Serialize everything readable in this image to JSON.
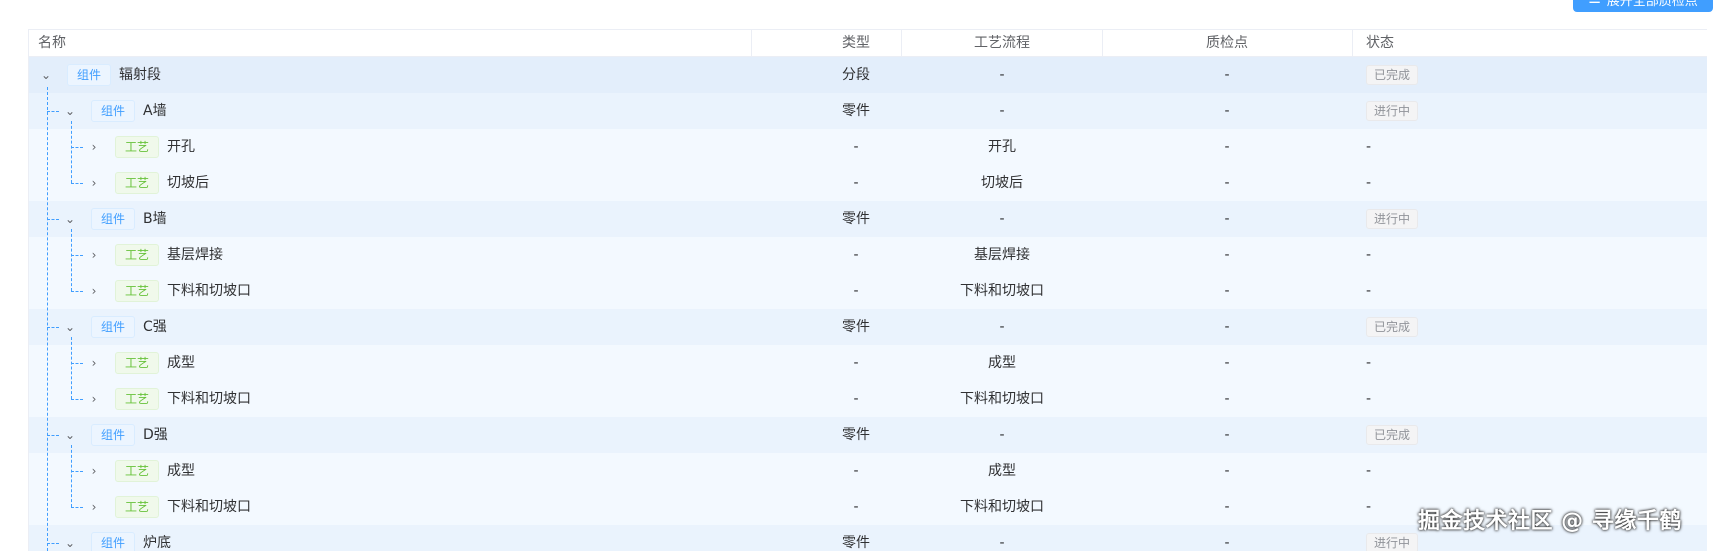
{
  "toolbar": {
    "expand_all_label": "展开全部质检点"
  },
  "columns": {
    "name": "名称",
    "type": "类型",
    "process": "工艺流程",
    "qc": "质检点",
    "status": "状态"
  },
  "rows": [
    {
      "tag": "组件",
      "name": "辐射段",
      "type": "分段",
      "process": "-",
      "qc": "-",
      "status": "已完成"
    },
    {
      "tag": "组件",
      "name": "A墙",
      "type": "零件",
      "process": "-",
      "qc": "-",
      "status": "进行中"
    },
    {
      "tag": "工艺",
      "name": "开孔",
      "type": "-",
      "process": "开孔",
      "qc": "-",
      "status": "-"
    },
    {
      "tag": "工艺",
      "name": "切坡后",
      "type": "-",
      "process": "切坡后",
      "qc": "-",
      "status": "-"
    },
    {
      "tag": "组件",
      "name": "B墙",
      "type": "零件",
      "process": "-",
      "qc": "-",
      "status": "进行中"
    },
    {
      "tag": "工艺",
      "name": "基层焊接",
      "type": "-",
      "process": "基层焊接",
      "qc": "-",
      "status": "-"
    },
    {
      "tag": "工艺",
      "name": "下料和切坡口",
      "type": "-",
      "process": "下料和切坡口",
      "qc": "-",
      "status": "-"
    },
    {
      "tag": "组件",
      "name": "C强",
      "type": "零件",
      "process": "-",
      "qc": "-",
      "status": "已完成"
    },
    {
      "tag": "工艺",
      "name": "成型",
      "type": "-",
      "process": "成型",
      "qc": "-",
      "status": "-"
    },
    {
      "tag": "工艺",
      "name": "下料和切坡口",
      "type": "-",
      "process": "下料和切坡口",
      "qc": "-",
      "status": "-"
    },
    {
      "tag": "组件",
      "name": "D强",
      "type": "零件",
      "process": "-",
      "qc": "-",
      "status": "已完成"
    },
    {
      "tag": "工艺",
      "name": "成型",
      "type": "-",
      "process": "成型",
      "qc": "-",
      "status": "-"
    },
    {
      "tag": "工艺",
      "name": "下料和切坡口",
      "type": "-",
      "process": "下料和切坡口",
      "qc": "-",
      "status": "-"
    },
    {
      "tag": "组件",
      "name": "炉底",
      "type": "零件",
      "process": "-",
      "qc": "-",
      "status": "进行中"
    }
  ],
  "watermark": "掘金技术社区 @ 寻缘千鹤",
  "colors": {
    "accent": "#409eff",
    "process_tag": "#67c23a",
    "status_tag_text": "#909399"
  }
}
